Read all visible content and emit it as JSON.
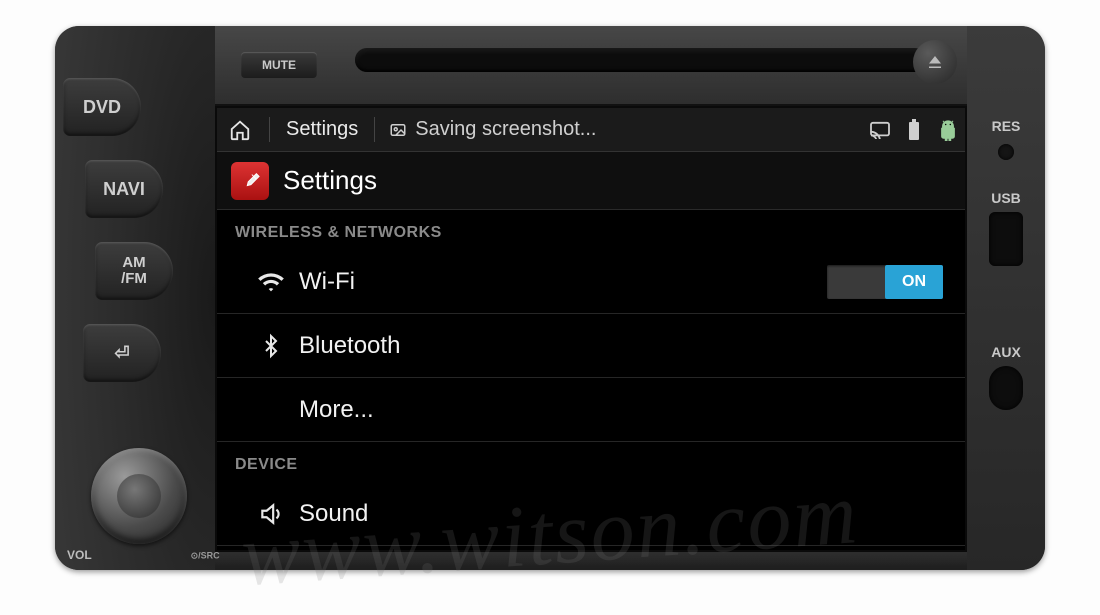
{
  "physical": {
    "left_buttons": [
      "DVD",
      "NAVI",
      "AM\n/FM",
      "⏎"
    ],
    "mute": "MUTE",
    "vol": "VOL",
    "src": "⊙/SRC",
    "right": {
      "res": "RES",
      "usb": "USB",
      "aux": "AUX"
    }
  },
  "statusbar": {
    "title": "Settings",
    "notification": "Saving screenshot..."
  },
  "app": {
    "header": "Settings",
    "sections": [
      {
        "label": "WIRELESS & NETWORKS",
        "rows": [
          {
            "key": "wifi",
            "label": "Wi-Fi",
            "toggle": "ON"
          },
          {
            "key": "bluetooth",
            "label": "Bluetooth"
          },
          {
            "key": "more",
            "label": "More..."
          }
        ]
      },
      {
        "label": "DEVICE",
        "rows": [
          {
            "key": "sound",
            "label": "Sound"
          }
        ]
      }
    ]
  },
  "watermark": "www.witson.com"
}
